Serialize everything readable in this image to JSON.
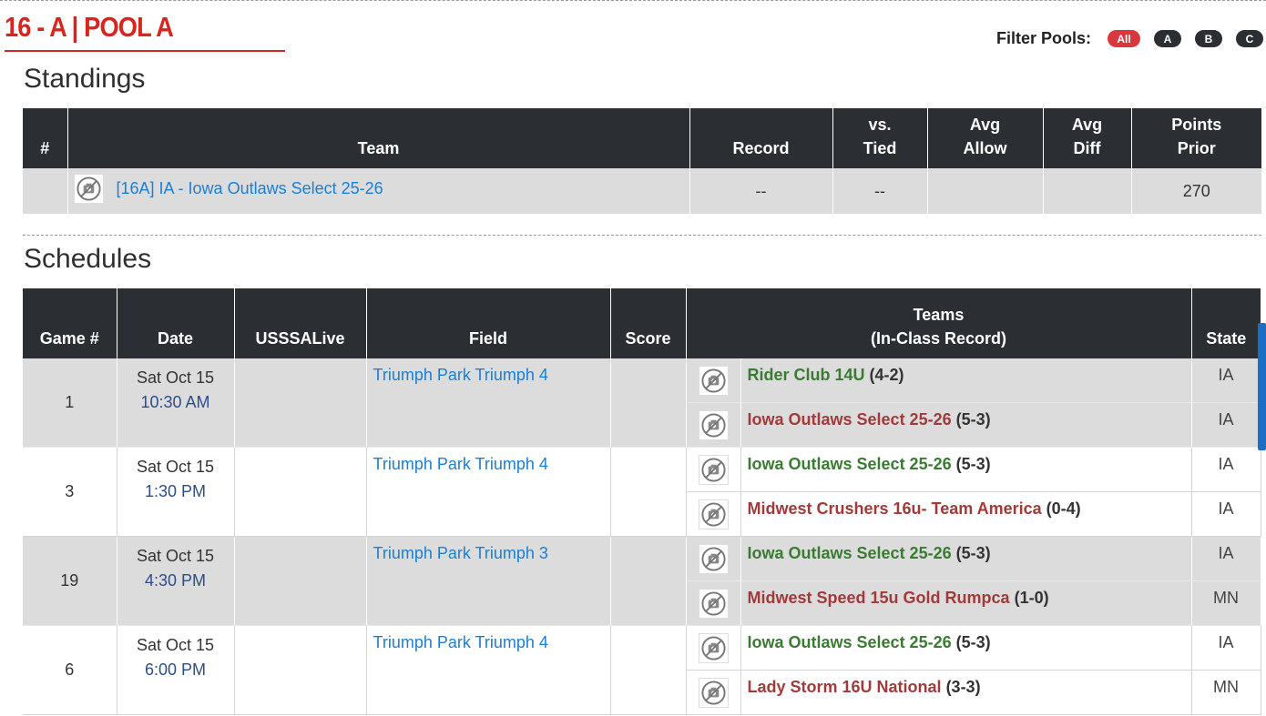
{
  "pool_title": "16 - A | POOL A",
  "filter": {
    "label": "Filter Pools:",
    "options": [
      "All",
      "A",
      "B",
      "C"
    ]
  },
  "standings": {
    "title": "Standings",
    "columns": [
      "#",
      "Team",
      "Record",
      "vs.\nTied",
      "Avg\nAllow",
      "Avg\nDiff",
      "Points\nPrior"
    ],
    "rows": [
      {
        "num": "",
        "team": "[16A] IA - Iowa Outlaws Select 25-26",
        "record": "--",
        "vs_tied": "--",
        "avg_allow": "",
        "avg_diff": "",
        "points_prior": "270"
      }
    ]
  },
  "schedules": {
    "title": "Schedules",
    "columns": [
      "Game #",
      "Date",
      "USSSALive",
      "Field",
      "Score",
      "Teams\n(In-Class Record)",
      "State"
    ],
    "games": [
      {
        "game": "1",
        "day": "Sat Oct 15",
        "time": "10:30 AM",
        "usssalive": "",
        "field": "Triumph Park Triumph 4",
        "score": "",
        "teams": [
          {
            "name": "Rider Club 14U",
            "record": "(4-2)",
            "state": "IA"
          },
          {
            "name": "Iowa Outlaws Select 25-26",
            "record": "(5-3)",
            "state": "IA"
          }
        ]
      },
      {
        "game": "3",
        "day": "Sat Oct 15",
        "time": "1:30 PM",
        "usssalive": "",
        "field": "Triumph Park Triumph 4",
        "score": "",
        "teams": [
          {
            "name": "Iowa Outlaws Select 25-26",
            "record": "(5-3)",
            "state": "IA"
          },
          {
            "name": "Midwest Crushers 16u- Team America",
            "record": "(0-4)",
            "state": "IA"
          }
        ]
      },
      {
        "game": "19",
        "day": "Sat Oct 15",
        "time": "4:30 PM",
        "usssalive": "",
        "field": "Triumph Park Triumph 3",
        "score": "",
        "teams": [
          {
            "name": "Iowa Outlaws Select 25-26",
            "record": "(5-3)",
            "state": "IA"
          },
          {
            "name": "Midwest Speed 15u Gold Rumpca",
            "record": "(1-0)",
            "state": "MN"
          }
        ]
      },
      {
        "game": "6",
        "day": "Sat Oct 15",
        "time": "6:00 PM",
        "usssalive": "",
        "field": "Triumph Park Triumph 4",
        "score": "",
        "teams": [
          {
            "name": "Iowa Outlaws Select 25-26",
            "record": "(5-3)",
            "state": "IA"
          },
          {
            "name": "Lady Storm 16U National",
            "record": "(3-3)",
            "state": "MN"
          }
        ]
      }
    ]
  },
  "colors": {
    "title_red": "#d8251f",
    "header_dark": "#2b2f33",
    "link_blue": "#1a7fd6",
    "home_green": "#3a7b32",
    "away_red": "#a33a3a",
    "filter_all_red": "#d9363e"
  },
  "icons": {
    "team_logo_placeholder": "no-image-icon"
  }
}
